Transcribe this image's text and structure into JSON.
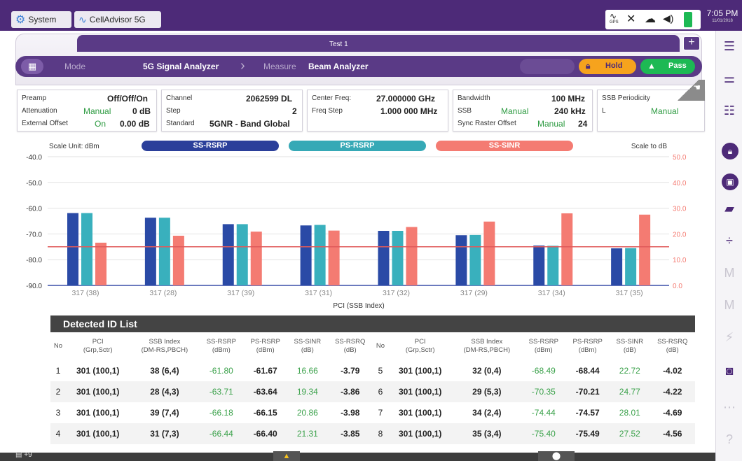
{
  "topbar": {
    "system_label": "System",
    "app_label": "CellAdvisor 5G",
    "gps_label": "GPS",
    "time": "7:05 PM",
    "date": "11/01/2018"
  },
  "testbar": {
    "test_name": "Test 1",
    "plus_label": "+"
  },
  "breadcrumb": {
    "mode_label": "Mode",
    "mode_value": "5G Signal Analyzer",
    "measure_label": "Measure",
    "measure_value": "Beam Analyzer",
    "hold_label": "Hold",
    "pass_label": "Pass"
  },
  "params": {
    "preamp_label": "Preamp",
    "preamp_value": "Off/Off/On",
    "attenuation_label": "Attenuation",
    "attenuation_mode": "Manual",
    "attenuation_value": "0 dB",
    "ext_offset_label": "External Offset",
    "ext_offset_state": "On",
    "ext_offset_value": "0.00 dB",
    "channel_label": "Channel",
    "channel_value": "2062599 DL",
    "step_label": "Step",
    "step_value": "2",
    "standard_label": "Standard",
    "standard_value": "5GNR - Band Global",
    "center_freq_label": "Center Freq:",
    "center_freq_value": "27.000000 GHz",
    "freq_step_label": "Freq Step",
    "freq_step_value": "1.000 000 MHz",
    "bandwidth_label": "Bandwidth",
    "bandwidth_value": "100 MHz",
    "ssb_label": "SSB",
    "ssb_mode": "Manual",
    "ssb_value": "240 kHz",
    "sync_raster_label": "Sync Raster Offset",
    "sync_raster_mode": "Manual",
    "sync_raster_value": "24",
    "ssb_periodicity_label": "SSB Periodicity",
    "l_label": "L",
    "l_mode": "Manual"
  },
  "chart_data": {
    "type": "bar",
    "left_axis_label": "Scale Unit: dBm",
    "right_axis_label": "Scale to dB",
    "xlabel": "PCI (SSB Index)",
    "left_ylim": [
      -90,
      -40
    ],
    "right_ylim": [
      0,
      50
    ],
    "left_ticks": [
      "-40.0",
      "-50.0",
      "-60.0",
      "-70.0",
      "-80.0",
      "-90.0"
    ],
    "right_ticks": [
      "50.0",
      "40.0",
      "30.0",
      "20.0",
      "10.0",
      "0.0"
    ],
    "categories": [
      "317 (38)",
      "317 (28)",
      "317 (39)",
      "317 (31)",
      "317 (32)",
      "317 (29)",
      "317 (34)",
      "317 (35)"
    ],
    "threshold_dbm": -75,
    "grid": true,
    "series": [
      {
        "name": "SS-RSRP",
        "axis": "left",
        "color": "#2a4aa6",
        "values": [
          -61.9,
          -63.7,
          -66.2,
          -66.7,
          -68.8,
          -70.5,
          -74.5,
          -75.6
        ]
      },
      {
        "name": "PS-RSRP",
        "axis": "left",
        "color": "#39b0bd",
        "values": [
          -61.9,
          -63.7,
          -66.2,
          -66.5,
          -68.8,
          -70.4,
          -74.6,
          -75.5
        ]
      },
      {
        "name": "SS-SINR",
        "axis": "right",
        "color": "#f47b72",
        "values": [
          16.6,
          19.3,
          20.9,
          21.3,
          22.7,
          24.8,
          28.0,
          27.5
        ]
      }
    ]
  },
  "table": {
    "title": "Detected ID List",
    "headers": [
      "No",
      "PCI\n(Grp,Sctr)",
      "SSB Index\n(DM-RS,PBCH)",
      "SS-RSRP\n(dBm)",
      "PS-RSRP\n(dBm)",
      "SS-SINR\n(dB)",
      "SS-RSRQ\n(dB)"
    ],
    "left_rows": [
      {
        "no": "1",
        "pci": "301 (100,1)",
        "ssb": "38 (6,4)",
        "ss_rsrp": "-61.80",
        "ps_rsrp": "-61.67",
        "ss_sinr": "16.66",
        "ss_rsrq": "-3.79"
      },
      {
        "no": "2",
        "pci": "301 (100,1)",
        "ssb": "28 (4,3)",
        "ss_rsrp": "-63.71",
        "ps_rsrp": "-63.64",
        "ss_sinr": "19.34",
        "ss_rsrq": "-3.86"
      },
      {
        "no": "3",
        "pci": "301 (100,1)",
        "ssb": "39 (7,4)",
        "ss_rsrp": "-66.18",
        "ps_rsrp": "-66.15",
        "ss_sinr": "20.86",
        "ss_rsrq": "-3.98"
      },
      {
        "no": "4",
        "pci": "301 (100,1)",
        "ssb": "31 (7,3)",
        "ss_rsrp": "-66.44",
        "ps_rsrp": "-66.40",
        "ss_sinr": "21.31",
        "ss_rsrq": "-3.85"
      }
    ],
    "right_rows": [
      {
        "no": "5",
        "pci": "301 (100,1)",
        "ssb": "32 (0,4)",
        "ss_rsrp": "-68.49",
        "ps_rsrp": "-68.44",
        "ss_sinr": "22.72",
        "ss_rsrq": "-4.02"
      },
      {
        "no": "6",
        "pci": "301 (100,1)",
        "ssb": "29 (5,3)",
        "ss_rsrp": "-70.35",
        "ps_rsrp": "-70.21",
        "ss_sinr": "24.77",
        "ss_rsrq": "-4.22"
      },
      {
        "no": "7",
        "pci": "301 (100,1)",
        "ssb": "34 (2,4)",
        "ss_rsrp": "-74.44",
        "ps_rsrp": "-74.57",
        "ss_sinr": "28.01",
        "ss_rsrq": "-4.69"
      },
      {
        "no": "8",
        "pci": "301 (100,1)",
        "ssb": "35 (3,4)",
        "ss_rsrp": "-75.40",
        "ps_rsrp": "-75.49",
        "ss_sinr": "27.52",
        "ss_rsrq": "-4.56"
      }
    ]
  },
  "bottombar": {
    "notif_count": "+9"
  },
  "colors": {
    "brand": "#4d2a78",
    "hold": "#f6a31d",
    "pass": "#1db954",
    "threshold": "#e05a5a"
  }
}
